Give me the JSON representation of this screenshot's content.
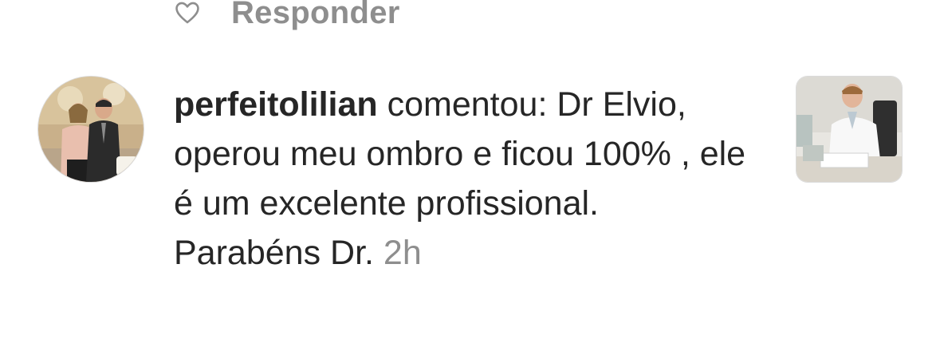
{
  "notification": {
    "reply_label": "Responder",
    "username": "perfeitolilian",
    "action_text": "comentou:",
    "comment_text": "Dr Elvio, operou meu ombro e ficou 100% , ele é um excelente profissional. Parabéns Dr.",
    "timestamp": "2h"
  },
  "icons": {
    "like": "heart-outline-icon"
  },
  "colors": {
    "text_primary": "#262626",
    "text_secondary": "#8e8e8e",
    "background": "#ffffff"
  }
}
